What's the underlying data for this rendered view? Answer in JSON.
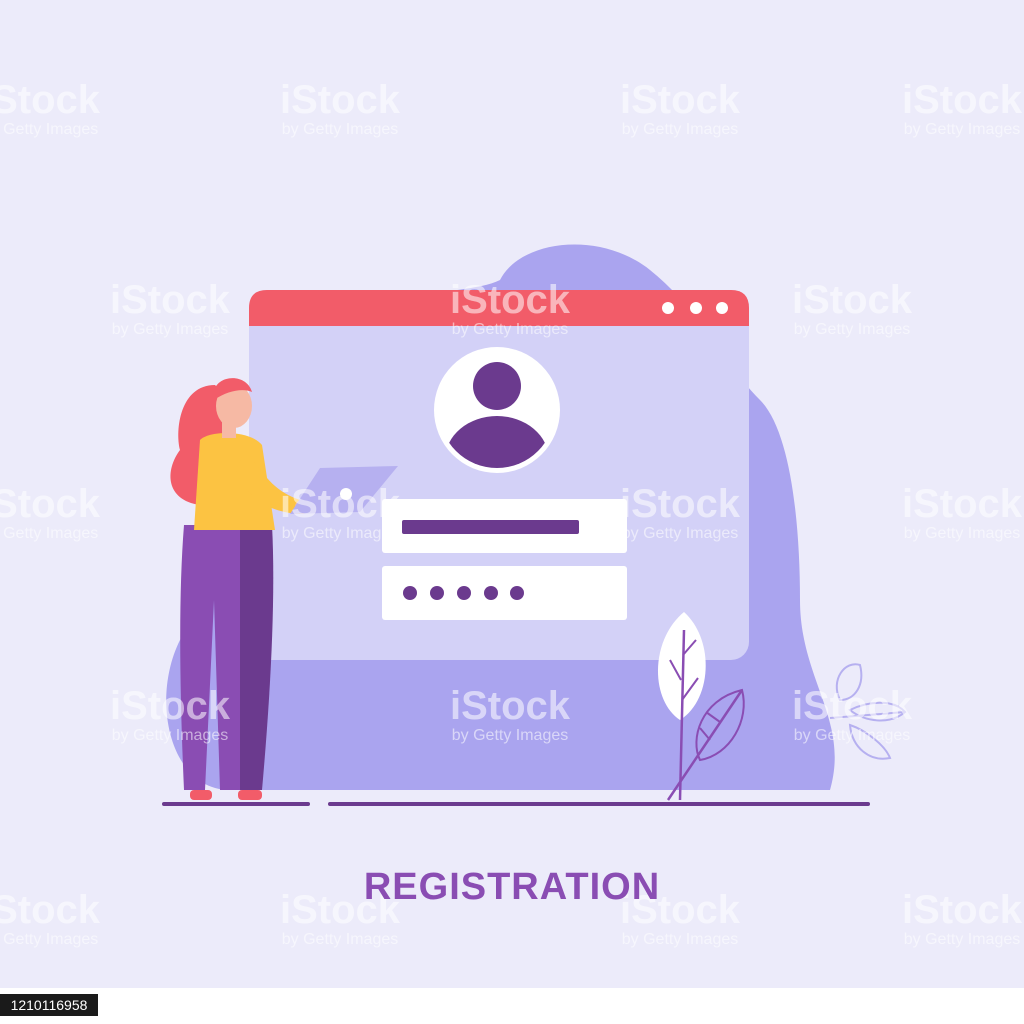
{
  "caption": "REGISTRATION",
  "image_id": "1210116958",
  "watermark": {
    "main": "iStock",
    "sub": "by Getty Images"
  },
  "form": {
    "username_value_hidden": "",
    "password_mask": "•••••"
  },
  "window": {
    "control_dots": 3
  },
  "colors": {
    "background": "#ecebfa",
    "window_header": "#f25c69",
    "window_body": "#d3d1f7",
    "blob": "#aaa4ef",
    "accent_purple": "#6b3a8e",
    "caption": "#8a4db3"
  },
  "icons": [
    "user-avatar-icon",
    "leaf-plant-icon",
    "window-dot-icon"
  ]
}
